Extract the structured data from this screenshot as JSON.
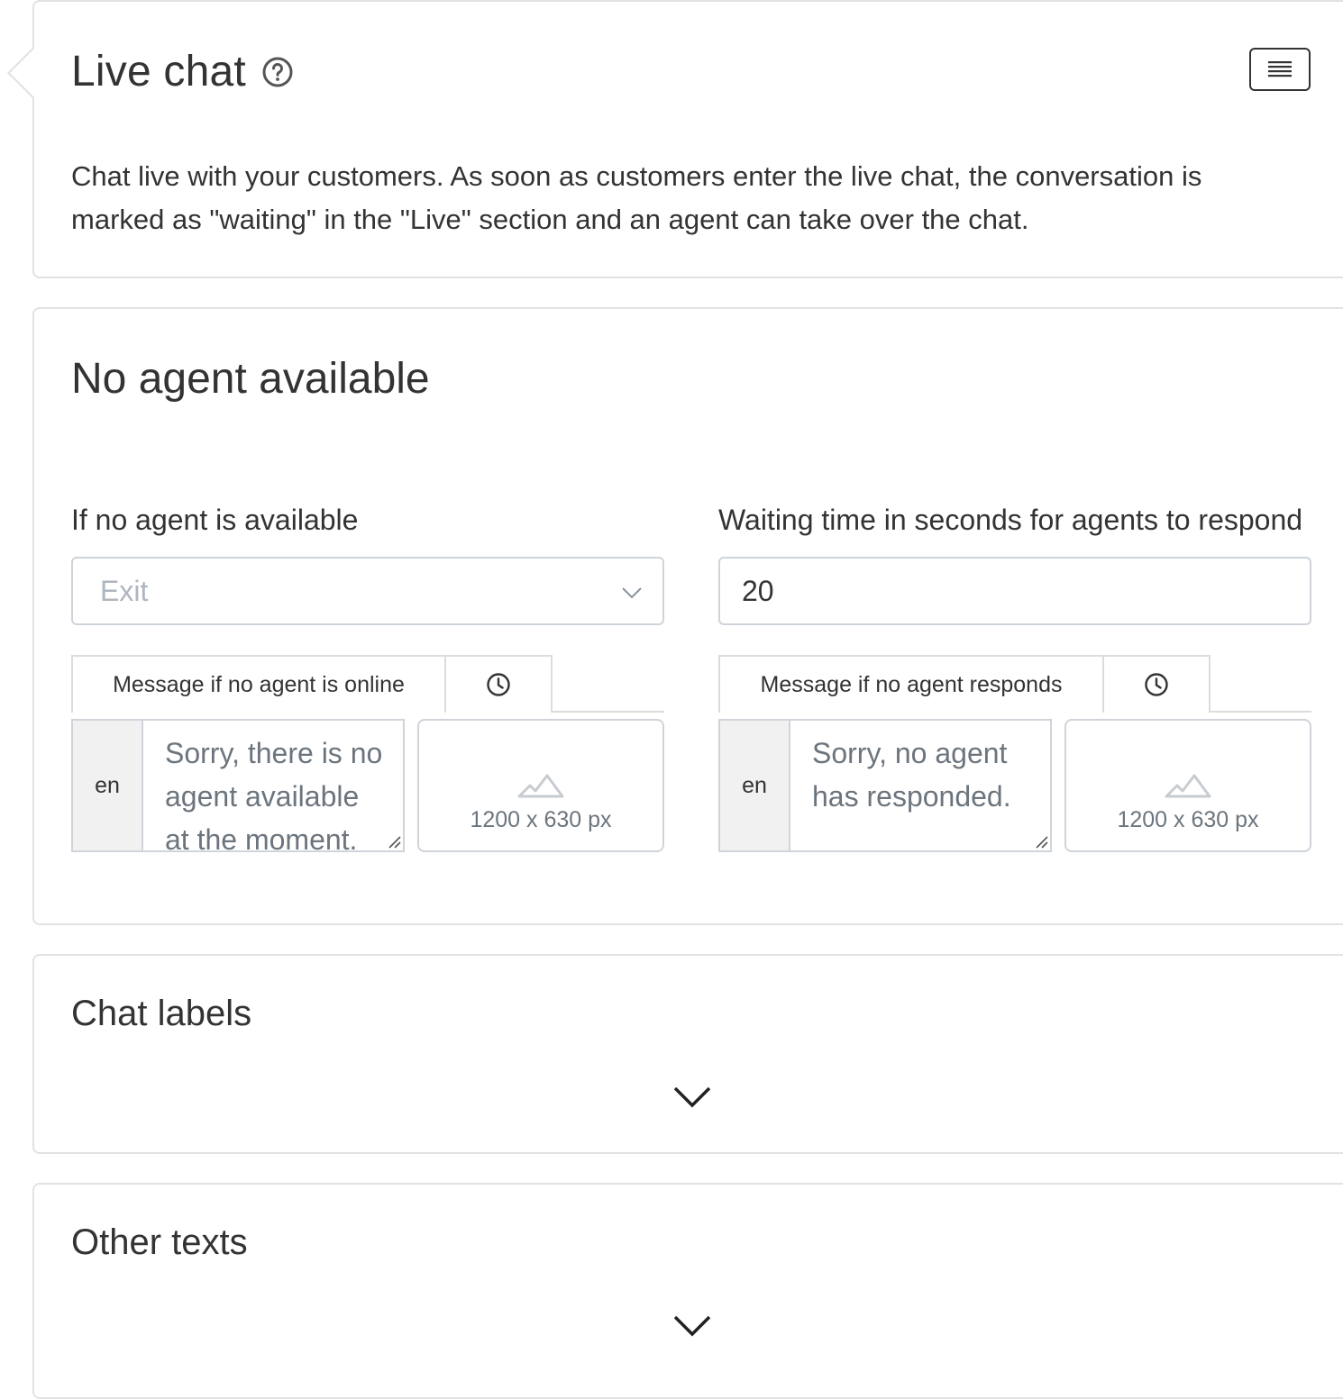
{
  "live_chat": {
    "title": "Live chat",
    "description": "Chat live with your customers. As soon as customers enter the live chat, the conversation is marked as \"waiting\" in the \"Live\" section and an agent can take over the chat."
  },
  "no_agent": {
    "title": "No agent available",
    "left": {
      "label": "If no agent is available",
      "select_value": "Exit",
      "tab_label": "Message if no agent is online",
      "lang": "en",
      "message": "Sorry, there is no agent available at the moment.",
      "image_hint": "1200 x 630 px"
    },
    "right": {
      "label": "Waiting time in seconds for agents to respond",
      "input_value": "20",
      "tab_label": "Message if no agent responds",
      "lang": "en",
      "message": "Sorry, no agent has responded.",
      "image_hint": "1200 x 630 px"
    }
  },
  "chat_labels": {
    "title": "Chat labels"
  },
  "other_texts": {
    "title": "Other texts"
  },
  "icons": {
    "help": "question-circle-icon",
    "menu": "hamburger-menu-icon",
    "clock": "clock-icon",
    "image": "image-placeholder-icon",
    "dropdown": "chevron-down-icon",
    "expand": "chevron-down-icon"
  },
  "colors": {
    "text": "#333333",
    "muted": "#6c757d",
    "placeholder": "#aeb6bf",
    "border": "#e2e2e2",
    "lang_bg": "#f1f1f1"
  }
}
